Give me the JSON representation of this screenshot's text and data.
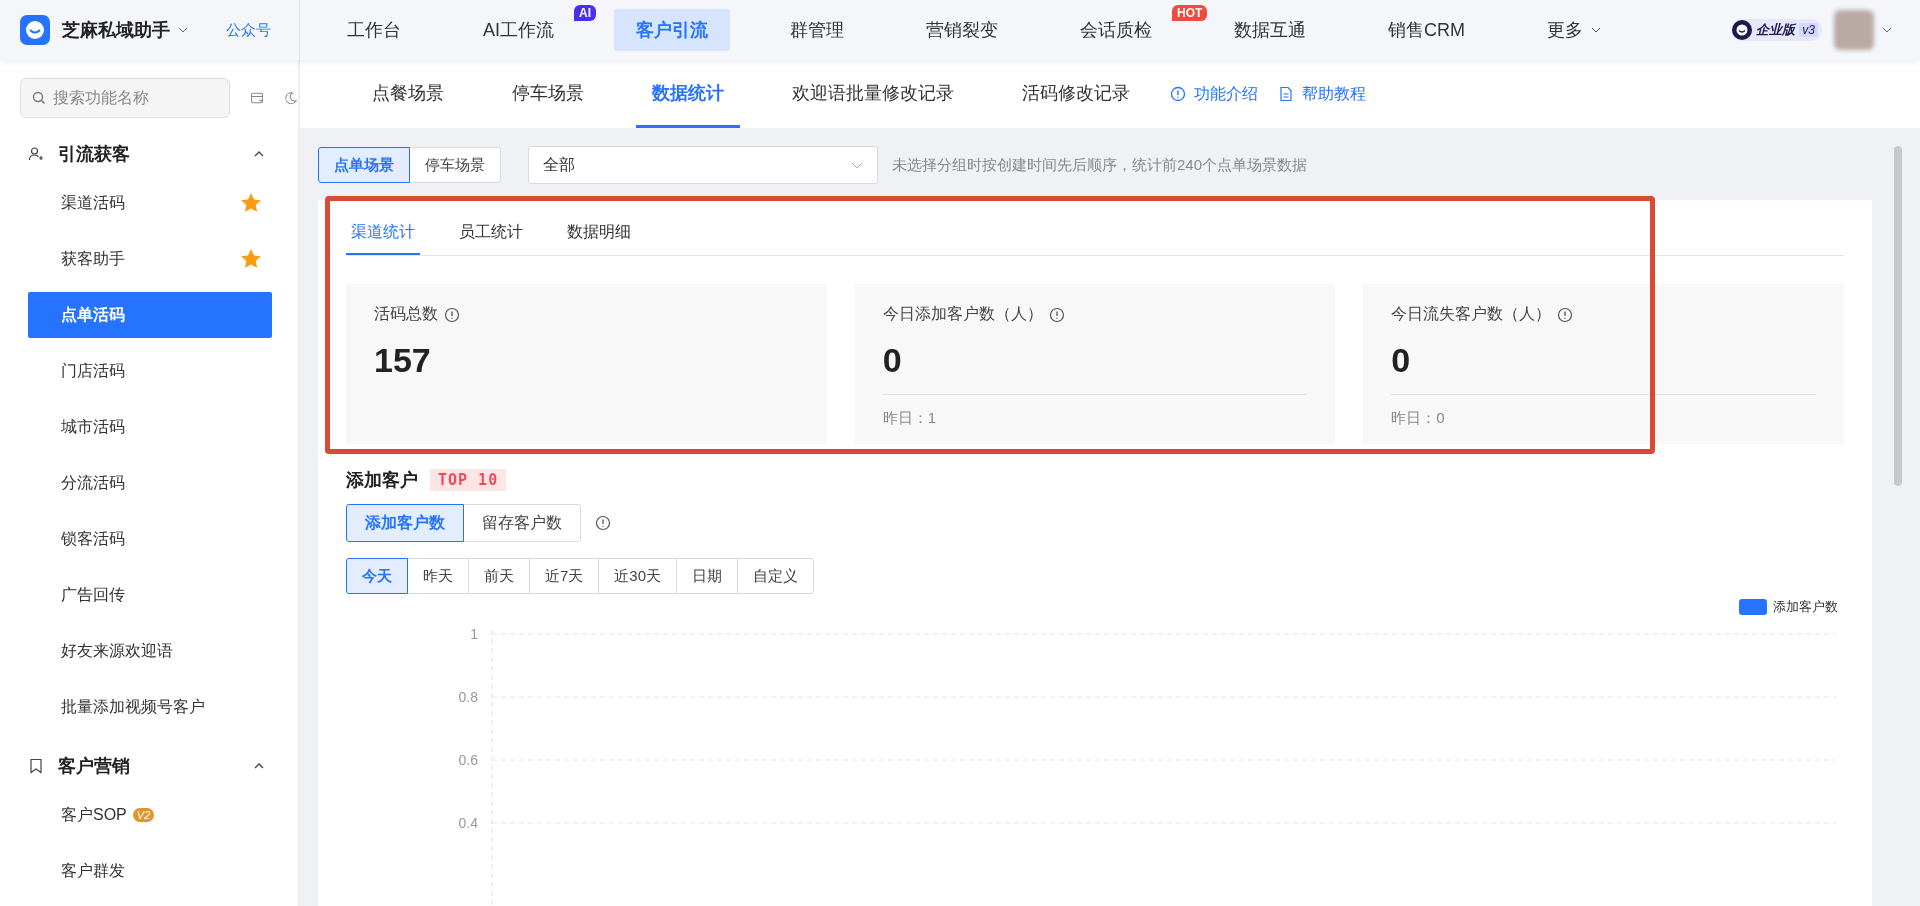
{
  "app": {
    "name": "芝麻私域助手",
    "link": "公众号"
  },
  "nav": [
    {
      "label": "工作台",
      "selected": false
    },
    {
      "label": "AI工作流",
      "selected": false,
      "badge": {
        "text": "AI",
        "color": "#4b2ff0"
      }
    },
    {
      "label": "客户引流",
      "selected": true
    },
    {
      "label": "群管理",
      "selected": false
    },
    {
      "label": "营销裂变",
      "selected": false
    },
    {
      "label": "会话质检",
      "selected": false,
      "badge": {
        "text": "HOT",
        "color": "#f24a3d"
      }
    },
    {
      "label": "数据互通",
      "selected": false
    },
    {
      "label": "销售CRM",
      "selected": false
    },
    {
      "label": "更多",
      "selected": false,
      "dropdown": true
    }
  ],
  "edition": {
    "label": "企业版",
    "version": "v3"
  },
  "sidebar": {
    "search": {
      "placeholder": "搜索功能名称"
    },
    "groups": [
      {
        "title": "引流获客",
        "expanded": true,
        "items": [
          {
            "label": "渠道活码",
            "selected": false,
            "starred": true
          },
          {
            "label": "获客助手",
            "selected": false,
            "starred": true
          },
          {
            "label": "点单活码",
            "selected": true,
            "starred": false
          },
          {
            "label": "门店活码",
            "selected": false,
            "starred": false
          },
          {
            "label": "城市活码",
            "selected": false,
            "starred": false
          },
          {
            "label": "分流活码",
            "selected": false,
            "starred": false
          },
          {
            "label": "锁客活码",
            "selected": false,
            "starred": false
          },
          {
            "label": "广告回传",
            "selected": false,
            "starred": false
          },
          {
            "label": "好友来源欢迎语",
            "selected": false,
            "starred": false
          },
          {
            "label": "批量添加视频号客户",
            "selected": false,
            "starred": false
          }
        ]
      },
      {
        "title": "客户营销",
        "expanded": true,
        "items": [
          {
            "label": "客户SOP",
            "selected": false,
            "starred": false,
            "badge": "V2"
          },
          {
            "label": "客户群发",
            "selected": false,
            "starred": false
          }
        ]
      }
    ]
  },
  "subtabs": [
    {
      "label": "点餐场景",
      "selected": false
    },
    {
      "label": "停车场景",
      "selected": false
    },
    {
      "label": "数据统计",
      "selected": true
    },
    {
      "label": "欢迎语批量修改记录",
      "selected": false
    },
    {
      "label": "活码修改记录",
      "selected": false
    }
  ],
  "help_links": [
    {
      "label": "功能介绍"
    },
    {
      "label": "帮助教程"
    }
  ],
  "filter": {
    "scenes": [
      {
        "label": "点单场景",
        "selected": true
      },
      {
        "label": "停车场景",
        "selected": false
      }
    ],
    "group_select": {
      "value": "全部"
    },
    "hint": "未选择分组时按创建时间先后顺序，统计前240个点单场景数据"
  },
  "stats_tabs": [
    {
      "label": "渠道统计",
      "selected": true
    },
    {
      "label": "员工统计",
      "selected": false
    },
    {
      "label": "数据明细",
      "selected": false
    }
  ],
  "stats": [
    {
      "label": "活码总数",
      "value": "157"
    },
    {
      "label": "今日添加客户数（人）",
      "value": "0",
      "yesterday": "昨日：1"
    },
    {
      "label": "今日流失客户数（人）",
      "value": "0",
      "yesterday": "昨日：0"
    }
  ],
  "ranking": {
    "title": "添加客户",
    "badge": "TOP 10",
    "metrics": [
      {
        "label": "添加客户数",
        "selected": true
      },
      {
        "label": "留存客户数",
        "selected": false
      }
    ],
    "ranges": [
      {
        "label": "今天",
        "selected": true
      },
      {
        "label": "昨天",
        "selected": false
      },
      {
        "label": "前天",
        "selected": false
      },
      {
        "label": "近7天",
        "selected": false
      },
      {
        "label": "近30天",
        "selected": false
      },
      {
        "label": "日期",
        "selected": false
      },
      {
        "label": "自定义",
        "selected": false
      }
    ],
    "chart_data": {
      "type": "bar",
      "ylim": [
        0,
        1
      ],
      "grid": true,
      "yticks": [
        0.4,
        0.6,
        0.8,
        1
      ],
      "series": [
        {
          "name": "添加客户数",
          "color": "#2673ff"
        }
      ]
    }
  }
}
